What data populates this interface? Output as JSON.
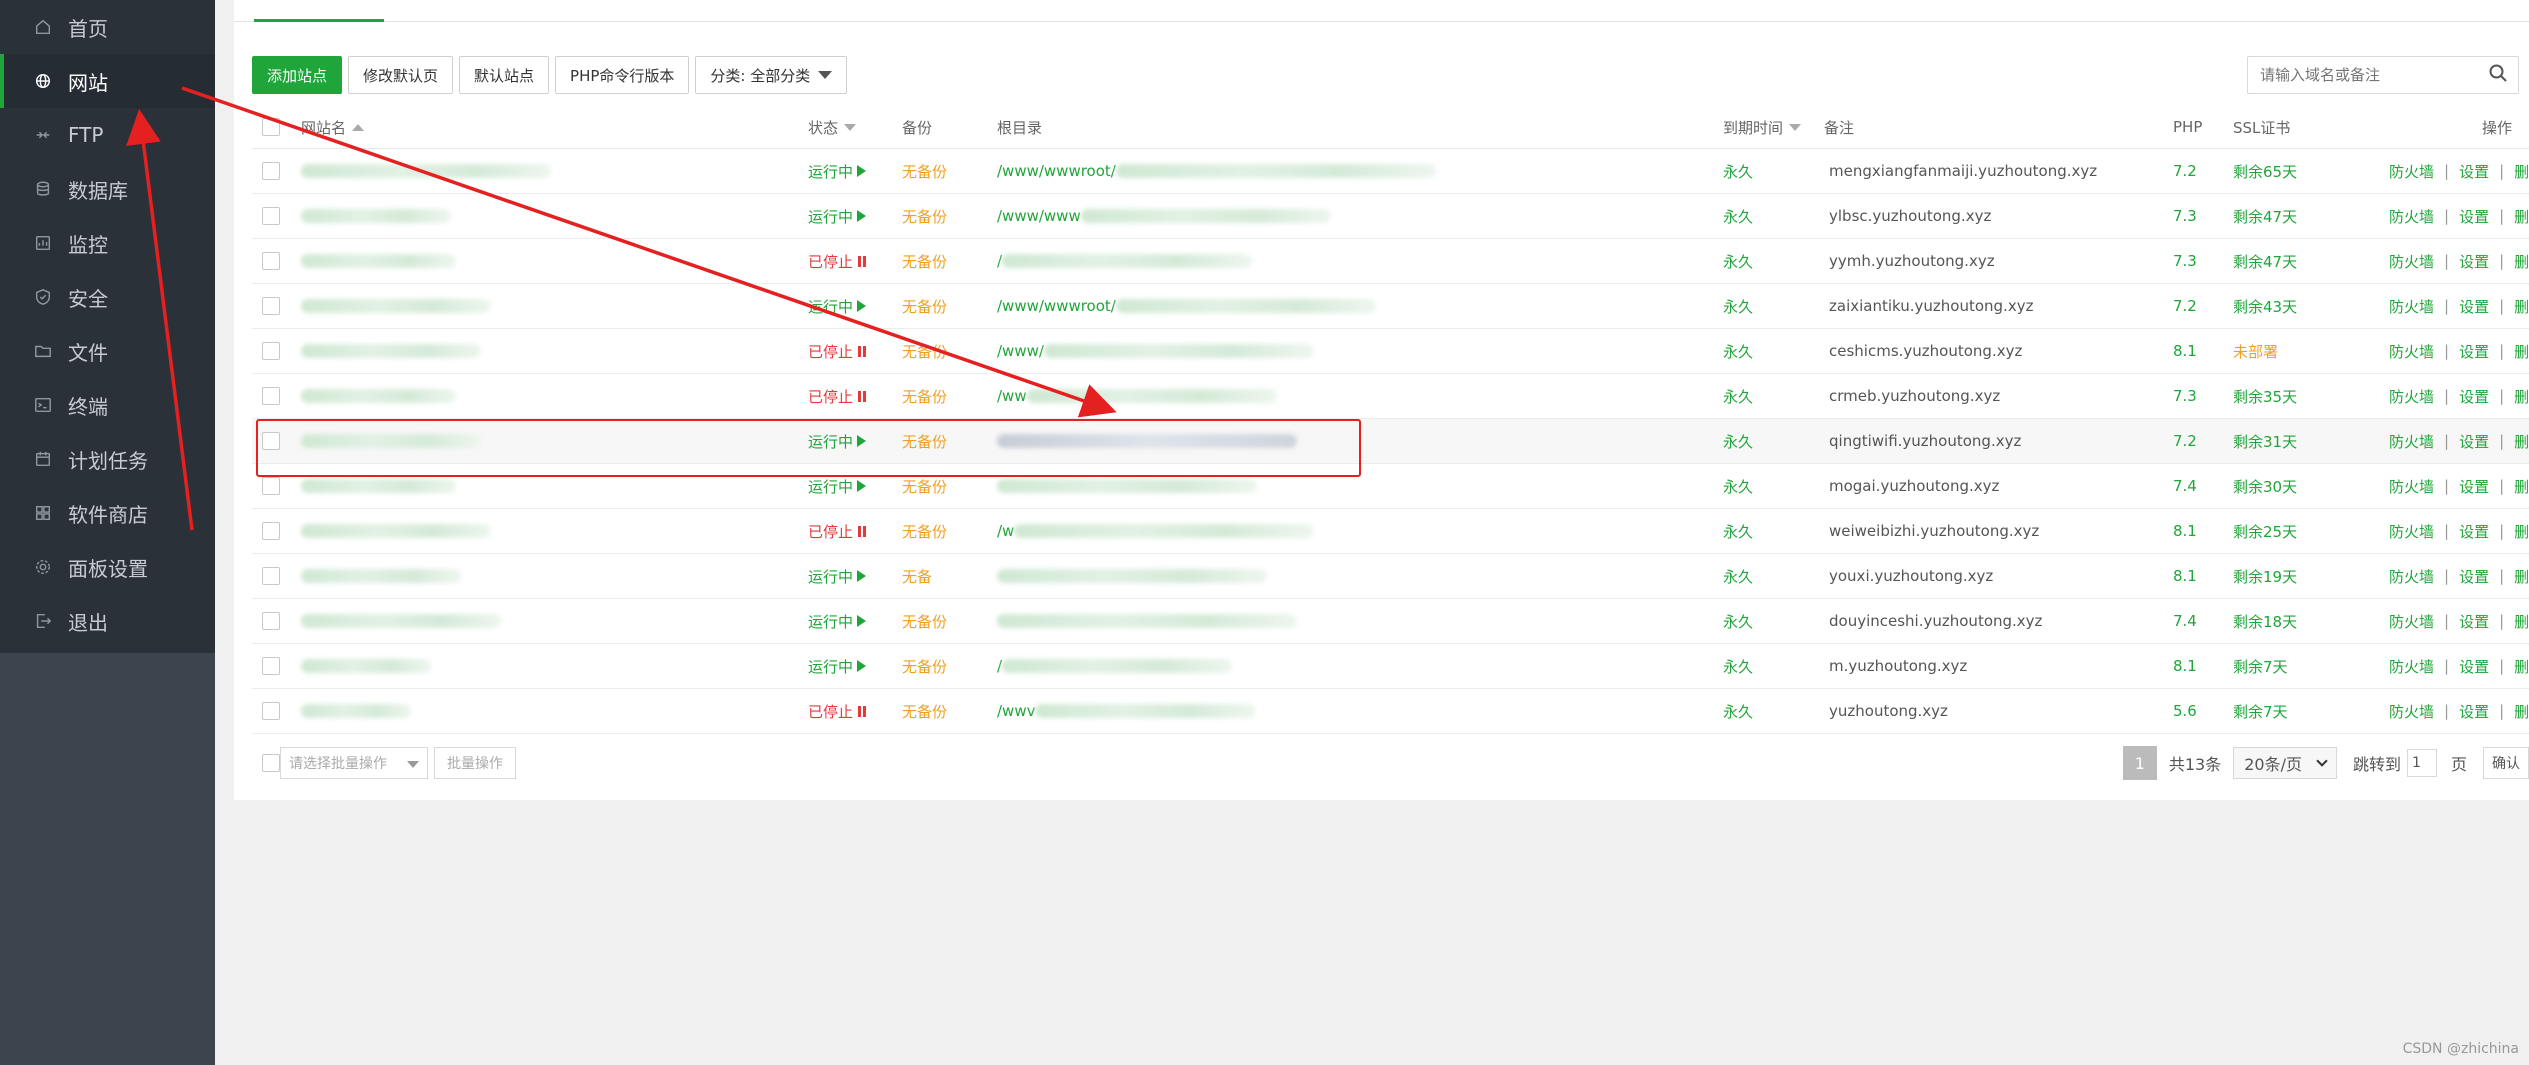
{
  "sidebar": {
    "items": [
      {
        "label": "首页",
        "icon": "home-icon"
      },
      {
        "label": "网站",
        "icon": "globe-icon",
        "active": true
      },
      {
        "label": "FTP",
        "icon": "ftp-icon"
      },
      {
        "label": "数据库",
        "icon": "database-icon"
      },
      {
        "label": "监控",
        "icon": "monitor-icon"
      },
      {
        "label": "安全",
        "icon": "shield-icon"
      },
      {
        "label": "文件",
        "icon": "folder-icon"
      },
      {
        "label": "终端",
        "icon": "terminal-icon"
      },
      {
        "label": "计划任务",
        "icon": "calendar-icon"
      },
      {
        "label": "软件商店",
        "icon": "grid-icon"
      },
      {
        "label": "面板设置",
        "icon": "gear-icon"
      },
      {
        "label": "退出",
        "icon": "logout-icon"
      }
    ]
  },
  "toolbar": {
    "add_site": "添加站点",
    "edit_default": "修改默认页",
    "default_site": "默认站点",
    "php_cli": "PHP命令行版本",
    "category": "分类: 全部分类"
  },
  "search": {
    "placeholder": "请输入域名或备注"
  },
  "table": {
    "headers": {
      "name": "网站名",
      "status": "状态",
      "backup": "备份",
      "root": "根目录",
      "expire": "到期时间",
      "note": "备注",
      "php": "PHP",
      "ssl": "SSL证书",
      "ops": "操作"
    },
    "rows": [
      {
        "status": "运行中",
        "running": true,
        "backup": "无备份",
        "root": "/www/wwwroot/",
        "expire": "永久",
        "note": "mengxiangfanmaiji.yuzhoutong.xyz",
        "php": "7.2",
        "ssl": "剩余65天"
      },
      {
        "status": "运行中",
        "running": true,
        "backup": "无备份",
        "root": "/www/www",
        "expire": "永久",
        "note": "ylbsc.yuzhoutong.xyz",
        "php": "7.3",
        "ssl": "剩余47天"
      },
      {
        "status": "已停止",
        "running": false,
        "backup": "无备份",
        "root": "/",
        "expire": "永久",
        "note": "yymh.yuzhoutong.xyz",
        "php": "7.3",
        "ssl": "剩余47天"
      },
      {
        "status": "运行中",
        "running": true,
        "backup": "无备份",
        "root": "/www/wwwroot/",
        "expire": "永久",
        "note": "zaixiantiku.yuzhoutong.xyz",
        "php": "7.2",
        "ssl": "剩余43天"
      },
      {
        "status": "已停止",
        "running": false,
        "backup": "无备份",
        "root": "/www/",
        "expire": "永久",
        "note": "ceshicms.yuzhoutong.xyz",
        "php": "8.1",
        "ssl": "未部署",
        "ssl_missing": true
      },
      {
        "status": "已停止",
        "running": false,
        "backup": "无备份",
        "root": "/ww",
        "expire": "永久",
        "note": "crmeb.yuzhoutong.xyz",
        "php": "7.3",
        "ssl": "剩余35天"
      },
      {
        "status": "运行中",
        "running": true,
        "backup": "无备份",
        "root": "",
        "expire": "永久",
        "note": "qingtiwifi.yuzhoutong.xyz",
        "php": "7.2",
        "ssl": "剩余31天",
        "highlight": true
      },
      {
        "status": "运行中",
        "running": true,
        "backup": "无备份",
        "root": "",
        "expire": "永久",
        "note": "mogai.yuzhoutong.xyz",
        "php": "7.4",
        "ssl": "剩余30天"
      },
      {
        "status": "已停止",
        "running": false,
        "backup": "无备份",
        "root": "/w",
        "expire": "永久",
        "note": "weiweibizhi.yuzhoutong.xyz",
        "php": "8.1",
        "ssl": "剩余25天"
      },
      {
        "status": "运行中",
        "running": true,
        "backup": "无备",
        "root": "",
        "expire": "永久",
        "note": "youxi.yuzhoutong.xyz",
        "php": "8.1",
        "ssl": "剩余19天"
      },
      {
        "status": "运行中",
        "running": true,
        "backup": "无备份",
        "root": "",
        "expire": "永久",
        "note": "douyinceshi.yuzhoutong.xyz",
        "php": "7.4",
        "ssl": "剩余18天"
      },
      {
        "status": "运行中",
        "running": true,
        "backup": "无备份",
        "root": "/",
        "expire": "永久",
        "note": "m.yuzhoutong.xyz",
        "php": "8.1",
        "ssl": "剩余7天"
      },
      {
        "status": "已停止",
        "running": false,
        "backup": "无备份",
        "root": "/wwv",
        "expire": "永久",
        "note": "yuzhoutong.xyz",
        "php": "5.6",
        "ssl": "剩余7天"
      }
    ],
    "ops": {
      "firewall": "防火墙",
      "settings": "设置",
      "delete": "删除",
      "sep": "|"
    }
  },
  "footer": {
    "batch_placeholder": "请选择批量操作",
    "batch_button": "批量操作",
    "current_page": "1",
    "total": "共13条",
    "page_size": "20条/页",
    "jump_label": "跳转到",
    "jump_value": "1",
    "page_unit": "页",
    "confirm": "确认"
  },
  "watermark": "CSDN @zhichina",
  "colors": {
    "accent": "#20a53a",
    "stopped": "#e5393a",
    "warning": "#f0a020",
    "annotation": "#e52020",
    "sidebar": "#2b3138"
  }
}
